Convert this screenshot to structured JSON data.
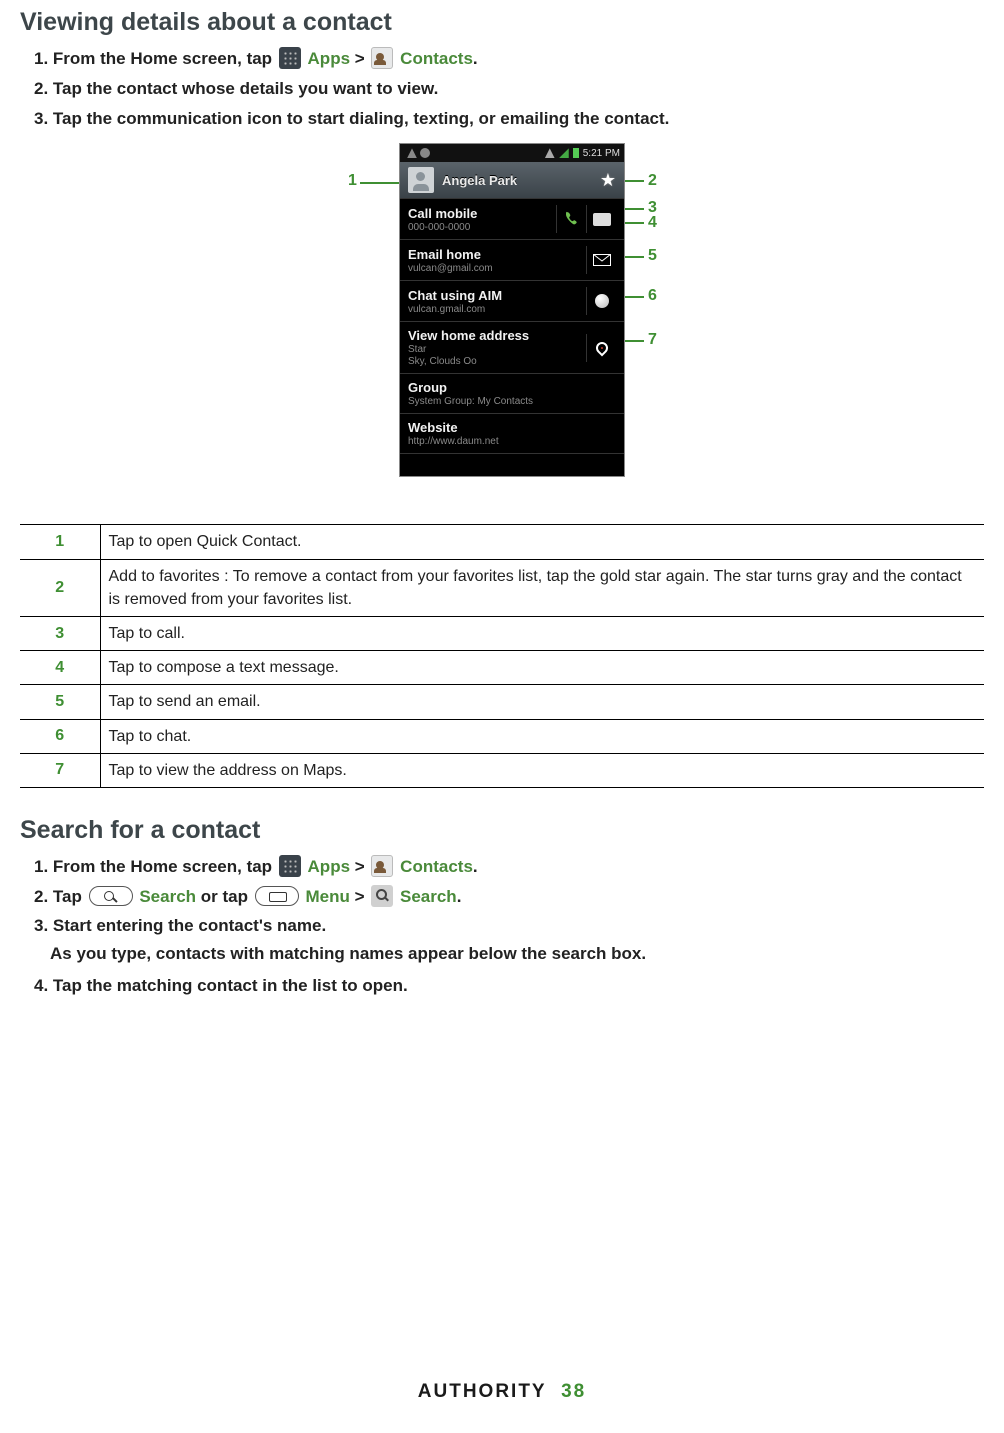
{
  "section1": {
    "title": "Viewing details about a contact",
    "steps": {
      "s1a": "1. From the Home screen, tap ",
      "apps": "Apps",
      "gt": ">",
      "contacts": "Contacts",
      "s1b": ".",
      "s2": "2. Tap the contact whose details you want to view.",
      "s3": "3. Tap the communication icon to start dialing, texting, or emailing the contact."
    }
  },
  "phone": {
    "time": "5:21 PM",
    "name": "Angela Park",
    "rows": [
      {
        "title": "Call mobile",
        "sub": "000-000-0000"
      },
      {
        "title": "Email home",
        "sub": "vulcan@gmail.com"
      },
      {
        "title": "Chat using AIM",
        "sub": "vulcan.gmail.com"
      },
      {
        "title": "View home address",
        "sub1": "Star",
        "sub2": "Sky, Clouds Oo"
      },
      {
        "title": "Group",
        "sub": "System Group: My Contacts"
      },
      {
        "title": "Website",
        "sub": "http://www.daum.net"
      }
    ]
  },
  "callouts": {
    "c1": "1",
    "c2": "2",
    "c3": "3",
    "c4": "4",
    "c5": "5",
    "c6": "6",
    "c7": "7"
  },
  "legend": [
    {
      "n": "1",
      "d": "Tap to open Quick Contact."
    },
    {
      "n": "2",
      "d": "Add to favorites : To remove a contact from your favorites list, tap the gold star again. The star turns gray and the contact is removed from your favorites list."
    },
    {
      "n": "3",
      "d": "Tap to call."
    },
    {
      "n": "4",
      "d": "Tap to compose a text message."
    },
    {
      "n": "5",
      "d": "Tap to send an email."
    },
    {
      "n": "6",
      "d": "Tap to chat."
    },
    {
      "n": "7",
      "d": "Tap to view the address on Maps."
    }
  ],
  "section2": {
    "title": "Search for a contact",
    "s1a": "1. From the Home screen, tap ",
    "apps": "Apps",
    "gt": ">",
    "contacts": "Contacts",
    "dot": ".",
    "s2a": "2. Tap ",
    "search": "Search",
    "s2b": " or tap ",
    "menu": "Menu",
    "s2gt": ">",
    "search2": "Search",
    "s2dot": ".",
    "s3": "3. Start entering the contact's name.",
    "s3b": "As you type, contacts with matching names appear below the search box.",
    "s4": "4. Tap the matching contact in the list to open."
  },
  "footer": {
    "brand": "AUTHORITY",
    "page": "38"
  }
}
